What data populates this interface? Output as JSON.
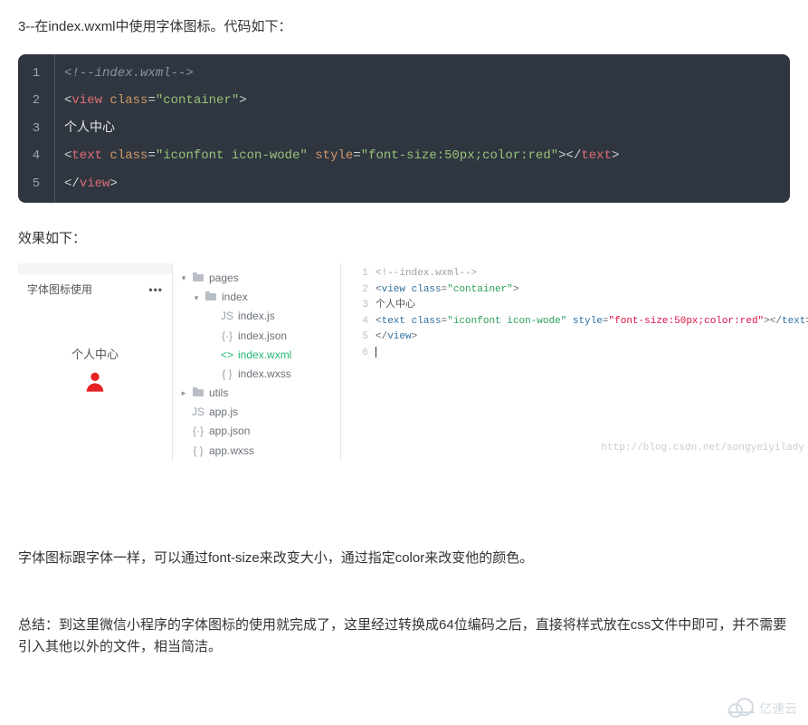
{
  "intro": "3--在index.wxml中使用字体图标。代码如下：",
  "code": {
    "lines": [
      {
        "n": "1",
        "segments": [
          {
            "cls": "c-comment",
            "t": "<!--index.wxml-->"
          }
        ]
      },
      {
        "n": "2",
        "segments": [
          {
            "cls": "c-punct",
            "t": "<"
          },
          {
            "cls": "c-tag",
            "t": "view"
          },
          {
            "cls": "c-punct",
            "t": " "
          },
          {
            "cls": "c-attr",
            "t": "class"
          },
          {
            "cls": "c-punct",
            "t": "="
          },
          {
            "cls": "c-string",
            "t": "\"container\""
          },
          {
            "cls": "c-punct",
            "t": ">"
          }
        ]
      },
      {
        "n": "3",
        "segments": [
          {
            "cls": "c-text",
            "t": "个人中心"
          }
        ]
      },
      {
        "n": "4",
        "segments": [
          {
            "cls": "c-punct",
            "t": "<"
          },
          {
            "cls": "c-tag",
            "t": "text"
          },
          {
            "cls": "c-punct",
            "t": " "
          },
          {
            "cls": "c-attr",
            "t": "class"
          },
          {
            "cls": "c-punct",
            "t": "="
          },
          {
            "cls": "c-string",
            "t": "\"iconfont icon-wode\""
          },
          {
            "cls": "c-punct",
            "t": " "
          },
          {
            "cls": "c-attr",
            "t": "style"
          },
          {
            "cls": "c-punct",
            "t": "="
          },
          {
            "cls": "c-string",
            "t": "\"font-size:50px;color:red\""
          },
          {
            "cls": "c-punct",
            "t": "></"
          },
          {
            "cls": "c-tag",
            "t": "text"
          },
          {
            "cls": "c-punct",
            "t": ">"
          }
        ]
      },
      {
        "n": "5",
        "segments": [
          {
            "cls": "c-punct",
            "t": "</"
          },
          {
            "cls": "c-tag",
            "t": "view"
          },
          {
            "cls": "c-punct",
            "t": ">"
          }
        ]
      }
    ]
  },
  "result_label": "效果如下：",
  "preview": {
    "title": "字体图标使用",
    "dots": "•••",
    "center_text": "个人中心",
    "icon_color": "#e62121"
  },
  "tree": {
    "items": [
      {
        "lvl": 1,
        "caret": "▾",
        "type": "folder",
        "label": "pages"
      },
      {
        "lvl": 2,
        "caret": "▾",
        "type": "folder",
        "label": "index"
      },
      {
        "lvl": 3,
        "caret": "",
        "type": "js",
        "label": "index.js"
      },
      {
        "lvl": 3,
        "caret": "",
        "type": "json",
        "label": "index.json"
      },
      {
        "lvl": 3,
        "caret": "",
        "type": "wxml",
        "label": "index.wxml",
        "selected": true
      },
      {
        "lvl": 3,
        "caret": "",
        "type": "wxss",
        "label": "index.wxss"
      },
      {
        "lvl": 1,
        "caret": "▸",
        "type": "folder",
        "label": "utils"
      },
      {
        "lvl": 1,
        "caret": "",
        "type": "js",
        "label": "app.js"
      },
      {
        "lvl": 1,
        "caret": "",
        "type": "json",
        "label": "app.json"
      },
      {
        "lvl": 1,
        "caret": "",
        "type": "wxss",
        "label": "app.wxss"
      }
    ]
  },
  "editor": {
    "lines": [
      {
        "n": "1",
        "segments": [
          {
            "cls": "e-comment",
            "t": "<!--index.wxml-->"
          }
        ]
      },
      {
        "n": "2",
        "segments": [
          {
            "cls": "e-punct",
            "t": "<"
          },
          {
            "cls": "e-tag",
            "t": "view "
          },
          {
            "cls": "e-attr",
            "t": "class"
          },
          {
            "cls": "e-punct",
            "t": "="
          },
          {
            "cls": "e-green",
            "t": "\"container\""
          },
          {
            "cls": "e-punct",
            "t": ">"
          }
        ]
      },
      {
        "n": "3",
        "segments": [
          {
            "cls": "e-plain",
            "t": "个人中心"
          }
        ]
      },
      {
        "n": "4",
        "segments": [
          {
            "cls": "e-punct",
            "t": "<"
          },
          {
            "cls": "e-tag",
            "t": "text "
          },
          {
            "cls": "e-attr",
            "t": "class"
          },
          {
            "cls": "e-punct",
            "t": "="
          },
          {
            "cls": "e-green",
            "t": "\"iconfont icon-wode\""
          },
          {
            "cls": "e-punct",
            "t": " "
          },
          {
            "cls": "e-attr",
            "t": "style"
          },
          {
            "cls": "e-punct",
            "t": "="
          },
          {
            "cls": "e-str",
            "t": "\"font-size:50px;color:red\""
          },
          {
            "cls": "e-punct",
            "t": "></"
          },
          {
            "cls": "e-tag",
            "t": "text"
          },
          {
            "cls": "e-punct",
            "t": ">"
          }
        ]
      },
      {
        "n": "5",
        "segments": [
          {
            "cls": "e-punct",
            "t": "</"
          },
          {
            "cls": "e-tag",
            "t": "view"
          },
          {
            "cls": "e-punct",
            "t": ">"
          }
        ]
      },
      {
        "n": "6",
        "segments": [
          {
            "cls": "e-plain",
            "t": ""
          }
        ]
      }
    ],
    "watermark": "http://blog.csdn.net/songyeiyilady"
  },
  "para": "字体图标跟字体一样，可以通过font-size来改变大小，通过指定color来改变他的颜色。",
  "summary": "总结：到这里微信小程序的字体图标的使用就完成了，这里经过转换成64位编码之后，直接将样式放在css文件中即可，并不需要引入其他以外的文件，相当简洁。",
  "brand": "亿速云"
}
